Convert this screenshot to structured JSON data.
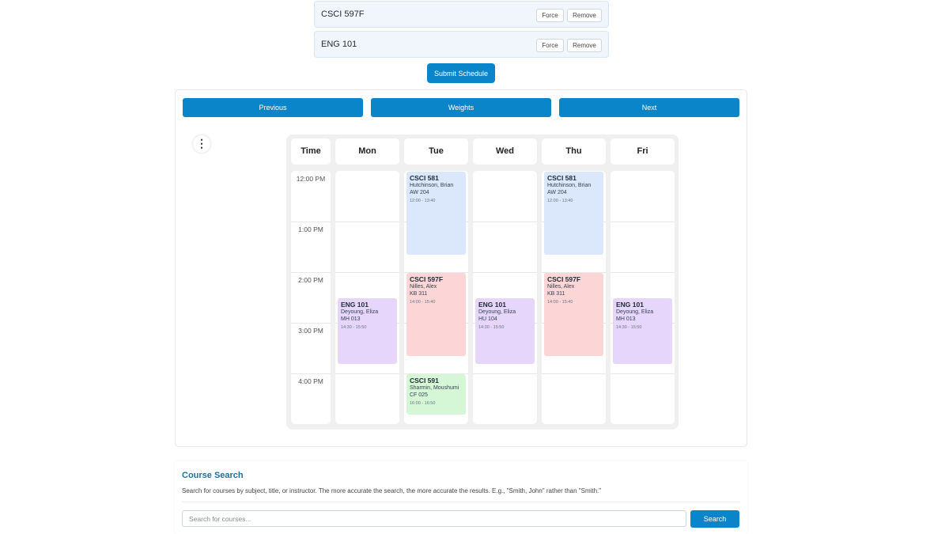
{
  "selected_courses": [
    {
      "code": "CSCI 597F",
      "force_label": "Force",
      "remove_label": "Remove"
    },
    {
      "code": "ENG 101",
      "force_label": "Force",
      "remove_label": "Remove"
    }
  ],
  "submit_label": "Submit Schedule",
  "nav": {
    "previous": "Previous",
    "weights": "Weights",
    "next": "Next"
  },
  "menu_icon": "more-vertical-icon",
  "menu_glyph": "⋮",
  "calendar": {
    "time_header": "Time",
    "days": [
      "Mon",
      "Tue",
      "Wed",
      "Thu",
      "Fri"
    ],
    "times": [
      "12:00 PM",
      "1:00 PM",
      "2:00 PM",
      "3:00 PM",
      "4:00 PM"
    ],
    "events": [
      {
        "day": 1,
        "code": "CSCI 581",
        "instructor": "Hutchinson, Brian",
        "room": "AW 204",
        "time": "12:00 - 13:40",
        "color": "blue"
      },
      {
        "day": 3,
        "code": "CSCI 581",
        "instructor": "Hutchinson, Brian",
        "room": "AW 204",
        "time": "12:00 - 13:40",
        "color": "blue"
      },
      {
        "day": 1,
        "code": "CSCI 597F",
        "instructor": "Nilles, Alex",
        "room": "KB 311",
        "time": "14:00 - 15:40",
        "color": "red"
      },
      {
        "day": 3,
        "code": "CSCI 597F",
        "instructor": "Nilles, Alex",
        "room": "KB 311",
        "time": "14:00 - 15:40",
        "color": "red"
      },
      {
        "day": 0,
        "code": "ENG 101",
        "instructor": "Deyoung, Eliza",
        "room": "MH 013",
        "time": "14:30 - 15:50",
        "color": "purple"
      },
      {
        "day": 2,
        "code": "ENG 101",
        "instructor": "Deyoung, Eliza",
        "room": "HU 104",
        "time": "14:30 - 15:50",
        "color": "purple"
      },
      {
        "day": 4,
        "code": "ENG 101",
        "instructor": "Deyoung, Eliza",
        "room": "MH 013",
        "time": "14:30 - 15:50",
        "color": "purple"
      },
      {
        "day": 1,
        "code": "CSCI 591",
        "instructor": "Sharmin, Moushumi",
        "room": "CF 025",
        "time": "16:00 - 16:50",
        "color": "green"
      }
    ]
  },
  "search": {
    "title": "Course Search",
    "description": "Search for courses by subject, title, or instructor. The more accurate the search, the more accurate the results. E.g., \"Smith, John\" rather than \"Smith.\"",
    "placeholder": "Search for courses...",
    "button": "Search"
  }
}
